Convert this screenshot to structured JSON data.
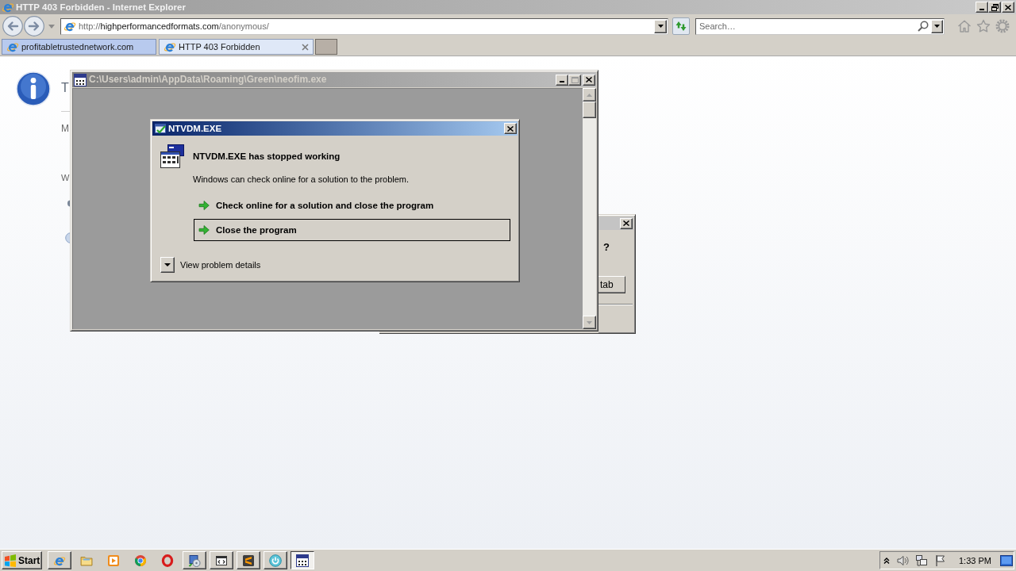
{
  "window": {
    "title": "HTTP 403 Forbidden - Internet Explorer"
  },
  "address_bar": {
    "scheme": "http://",
    "host": "highperformancedformats.com",
    "path": "/anonymous/"
  },
  "search_box": {
    "placeholder": "Search…"
  },
  "tabs": [
    {
      "label": "profitabletrustednetwork.com",
      "selected": false
    },
    {
      "label": "HTTP 403 Forbidden",
      "selected": true
    }
  ],
  "page": {
    "heading": "T",
    "paragraph_1": "M",
    "paragraph_2": "W"
  },
  "background_dialog": {
    "question": "?",
    "button": "tab"
  },
  "console_window": {
    "title": "C:\\Users\\admin\\AppData\\Roaming\\Green\\neofim.exe"
  },
  "error_dialog": {
    "title": "NTVDM.EXE",
    "heading": "NTVDM.EXE has stopped working",
    "message": "Windows can check online for a solution to the problem.",
    "options": [
      {
        "label": "Check online for a solution and close the program",
        "selected": false
      },
      {
        "label": "Close the program",
        "selected": true
      }
    ],
    "details": {
      "label": "View problem details",
      "expanded": false
    }
  },
  "taskbar": {
    "start": "Start",
    "items": [
      {
        "kind": "ie",
        "running": true,
        "selected": false
      },
      {
        "kind": "folder",
        "running": false,
        "selected": false
      },
      {
        "kind": "player",
        "running": false,
        "selected": false
      },
      {
        "kind": "chrome",
        "running": false,
        "selected": false
      },
      {
        "kind": "opera",
        "running": false,
        "selected": false
      },
      {
        "kind": "installer",
        "running": true,
        "selected": false
      },
      {
        "kind": "codewindow",
        "running": true,
        "selected": false
      },
      {
        "kind": "sublime",
        "running": true,
        "selected": false
      },
      {
        "kind": "power",
        "running": true,
        "selected": false
      },
      {
        "kind": "console",
        "running": true,
        "selected": true
      }
    ],
    "clock": "1:33 PM"
  }
}
